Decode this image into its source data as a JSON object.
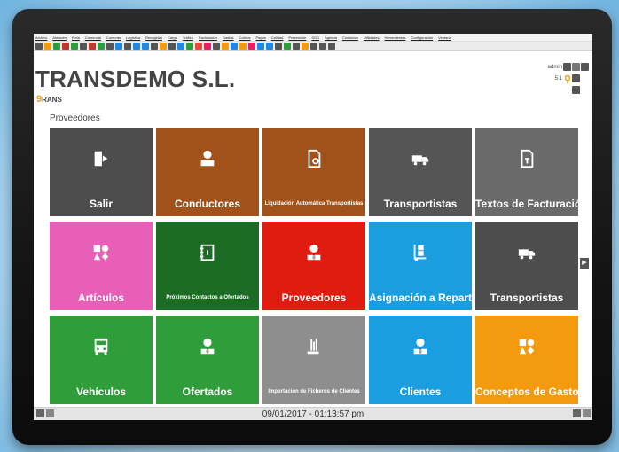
{
  "menu": [
    "Archivo",
    "Almacén",
    "Flota",
    "Comercial",
    "Compras",
    "Logística",
    "Recogidas",
    "Carga",
    "Tráfico",
    "Facturación",
    "Gastos",
    "Cobros",
    "Pagos",
    "Calidad",
    "Prevención",
    "SGD",
    "Agenda",
    "Contactos",
    "Utilidades",
    "Herramientas",
    "Configuración",
    "Ventana"
  ],
  "toolbar_colors": [
    "#555",
    "#f39c12",
    "#2e9c3f",
    "#c0392b",
    "#2e9c3f",
    "#555",
    "#c0392b",
    "#2e9c3f",
    "#555",
    "#1e88e5",
    "#555",
    "#1e88e5",
    "#1e88e5",
    "#555",
    "#f39c12",
    "#555",
    "#1e88e5",
    "#2e9c3f",
    "#e74c3c",
    "#e91e63",
    "#555",
    "#f39c12",
    "#1e88e5",
    "#f39c12",
    "#e91e63",
    "#1e88e5",
    "#1e88e5",
    "#555",
    "#2e9c3f",
    "#555",
    "#f39c12",
    "#555",
    "#555",
    "#555"
  ],
  "header": {
    "company": "TRANSDEMO S.L.",
    "logo_text": "RANS",
    "logo_mark": "9",
    "section": "Proveedores",
    "user": "admin",
    "version": "5.1"
  },
  "tiles": [
    {
      "label": "Salir",
      "icon": "exit-icon",
      "color": "#4d4d4d",
      "small": false
    },
    {
      "label": "Conductores",
      "icon": "person-icon",
      "color": "#a0521a",
      "small": false
    },
    {
      "label": "Liquidación Automática Transportistas",
      "icon": "document-icon",
      "color": "#a0521a",
      "small": true
    },
    {
      "label": "Transportistas",
      "icon": "truck-icon",
      "color": "#555555",
      "small": false
    },
    {
      "label": "Textos de Facturación",
      "icon": "text-document-icon",
      "color": "#6a6a6a",
      "small": false
    },
    {
      "label": "Artículos",
      "icon": "shapes-icon",
      "color": "#e85fb8",
      "small": false
    },
    {
      "label": "Próximos Contactos a Ofertados",
      "icon": "address-book-icon",
      "color": "#1b6b24",
      "small": true
    },
    {
      "label": "Proveedores",
      "icon": "person-tie-icon",
      "color": "#e01b10",
      "small": false
    },
    {
      "label": "Asignación a Reparto",
      "icon": "hand-truck-icon",
      "color": "#1a9ee0",
      "small": false
    },
    {
      "label": "Transportistas",
      "icon": "truck-icon",
      "color": "#4d4d4d",
      "small": false
    },
    {
      "label": "Vehículos",
      "icon": "bus-icon",
      "color": "#2f9e3a",
      "small": false
    },
    {
      "label": "Ofertados",
      "icon": "person-tie-icon",
      "color": "#2f9e3a",
      "small": false
    },
    {
      "label": "Importación de Ficheros de Clientes",
      "icon": "import-icon",
      "color": "#8e8e8e",
      "small": true
    },
    {
      "label": "Clientes",
      "icon": "person-tie-icon",
      "color": "#1a9ee0",
      "small": false
    },
    {
      "label": "Conceptos de Gasto",
      "icon": "shapes-icon",
      "color": "#f39a0e",
      "small": false
    }
  ],
  "footer": {
    "datetime": "09/01/2017 - 01:13:57 pm"
  }
}
